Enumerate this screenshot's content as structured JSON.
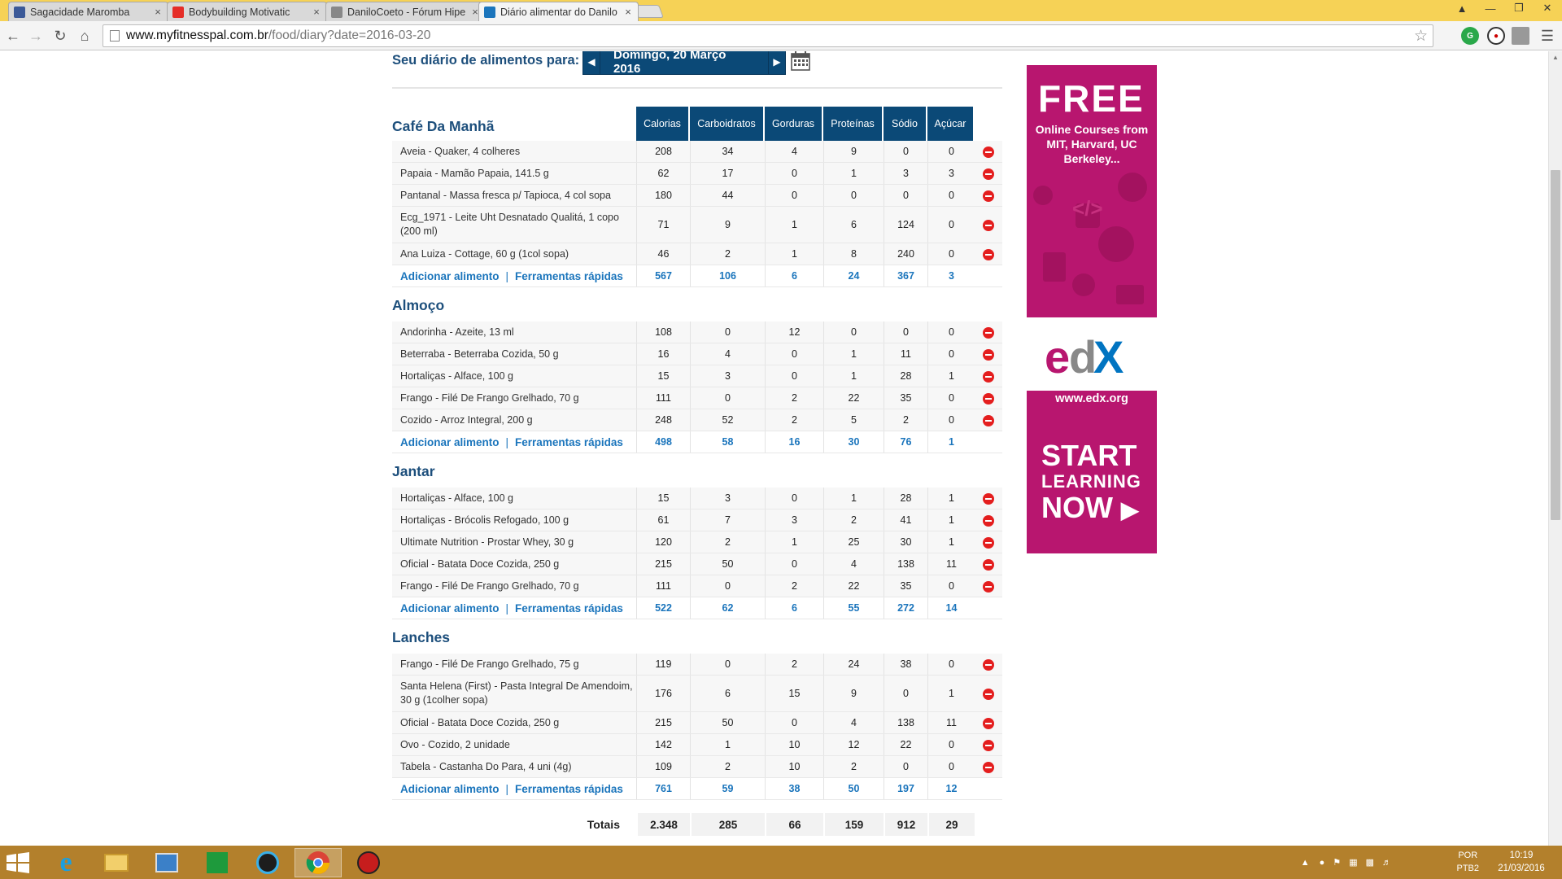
{
  "browser": {
    "tabs": [
      {
        "title": "Sagacidade Maromba",
        "icon": "facebook-icon",
        "color": "#3b5998",
        "active": false
      },
      {
        "title": "Bodybuilding Motivatic",
        "icon": "youtube-icon",
        "color": "#e52d27",
        "active": false
      },
      {
        "title": "DaniloCoeto - Fórum Hipe",
        "icon": "page-icon",
        "color": "#888888",
        "active": false
      },
      {
        "title": "Diário alimentar do Danilo",
        "icon": "myfitnesspal-icon",
        "color": "#1b75bc",
        "active": true
      }
    ],
    "url_host": "www.myfitnesspal.com.br",
    "url_path": "/food/diary?date=2016-03-20"
  },
  "diary": {
    "header_label": "Seu diário de alimentos para:",
    "date": "Domingo, 20 Março 2016",
    "columns": [
      "Calorias",
      "Carboidratos",
      "Gorduras",
      "Proteínas",
      "Sódio",
      "Açúcar"
    ],
    "add_food": "Adicionar alimento",
    "quick_tools": "Ferramentas rápidas",
    "meals": [
      {
        "name": "Café Da Manhã",
        "foods": [
          {
            "name": "Aveia - Quaker, 4 colheres",
            "values": [
              "208",
              "34",
              "4",
              "9",
              "0",
              "0"
            ]
          },
          {
            "name": "Papaia - Mamão Papaia, 141.5 g",
            "values": [
              "62",
              "17",
              "0",
              "1",
              "3",
              "3"
            ]
          },
          {
            "name": "Pantanal - Massa fresca p/ Tapioca, 4 col sopa",
            "values": [
              "180",
              "44",
              "0",
              "0",
              "0",
              "0"
            ]
          },
          {
            "name": "Ecg_1971 - Leite Uht Desnatado Qualitá, 1 copo (200 ml)",
            "values": [
              "71",
              "9",
              "1",
              "6",
              "124",
              "0"
            ]
          },
          {
            "name": "Ana Luiza - Cottage, 60 g (1col sopa)",
            "values": [
              "46",
              "2",
              "1",
              "8",
              "240",
              "0"
            ]
          }
        ],
        "totals": [
          "567",
          "106",
          "6",
          "24",
          "367",
          "3"
        ]
      },
      {
        "name": "Almoço",
        "foods": [
          {
            "name": "Andorinha - Azeite, 13 ml",
            "values": [
              "108",
              "0",
              "12",
              "0",
              "0",
              "0"
            ]
          },
          {
            "name": "Beterraba - Beterraba Cozida, 50 g",
            "values": [
              "16",
              "4",
              "0",
              "1",
              "11",
              "0"
            ]
          },
          {
            "name": "Hortaliças - Alface, 100 g",
            "values": [
              "15",
              "3",
              "0",
              "1",
              "28",
              "1"
            ]
          },
          {
            "name": "Frango - Filé De Frango Grelhado, 70 g",
            "values": [
              "111",
              "0",
              "2",
              "22",
              "35",
              "0"
            ]
          },
          {
            "name": "Cozido - Arroz Integral, 200 g",
            "values": [
              "248",
              "52",
              "2",
              "5",
              "2",
              "0"
            ]
          }
        ],
        "totals": [
          "498",
          "58",
          "16",
          "30",
          "76",
          "1"
        ]
      },
      {
        "name": "Jantar",
        "foods": [
          {
            "name": "Hortaliças - Alface, 100 g",
            "values": [
              "15",
              "3",
              "0",
              "1",
              "28",
              "1"
            ]
          },
          {
            "name": "Hortaliças - Brócolis Refogado, 100 g",
            "values": [
              "61",
              "7",
              "3",
              "2",
              "41",
              "1"
            ]
          },
          {
            "name": "Ultimate Nutrition - Prostar Whey, 30 g",
            "values": [
              "120",
              "2",
              "1",
              "25",
              "30",
              "1"
            ]
          },
          {
            "name": "Oficial - Batata Doce Cozida, 250 g",
            "values": [
              "215",
              "50",
              "0",
              "4",
              "138",
              "11"
            ]
          },
          {
            "name": "Frango - Filé De Frango Grelhado, 70 g",
            "values": [
              "111",
              "0",
              "2",
              "22",
              "35",
              "0"
            ]
          }
        ],
        "totals": [
          "522",
          "62",
          "6",
          "55",
          "272",
          "14"
        ]
      },
      {
        "name": "Lanches",
        "foods": [
          {
            "name": "Frango - Filé De Frango Grelhado, 75 g",
            "values": [
              "119",
              "0",
              "2",
              "24",
              "38",
              "0"
            ]
          },
          {
            "name": "Santa Helena (First) - Pasta Integral De Amendoim, 30 g (1colher sopa)",
            "values": [
              "176",
              "6",
              "15",
              "9",
              "0",
              "1"
            ]
          },
          {
            "name": "Oficial - Batata Doce Cozida, 250 g",
            "values": [
              "215",
              "50",
              "0",
              "4",
              "138",
              "11"
            ]
          },
          {
            "name": "Ovo - Cozido, 2 unidade",
            "values": [
              "142",
              "1",
              "10",
              "12",
              "22",
              "0"
            ]
          },
          {
            "name": "Tabela - Castanha Do Para, 4 uni (4g)",
            "values": [
              "109",
              "2",
              "10",
              "2",
              "0",
              "0"
            ]
          }
        ],
        "totals": [
          "761",
          "59",
          "38",
          "50",
          "197",
          "12"
        ]
      }
    ],
    "grand_totals_label": "Totais",
    "grand_totals": [
      "2.348",
      "285",
      "66",
      "159",
      "912",
      "29"
    ]
  },
  "ad": {
    "headline": "FREE",
    "subtitle": "Online Courses from MIT, Harvard, UC Berkeley...",
    "brand": "edX",
    "url": "www.edx.org",
    "cta_line1": "START",
    "cta_line2": "LEARNING",
    "cta_line3": "NOW",
    "brand_color": "#b8166f"
  },
  "taskbar": {
    "lang": "POR",
    "layout": "PTB2",
    "time": "10:19",
    "date": "21/03/2016"
  }
}
